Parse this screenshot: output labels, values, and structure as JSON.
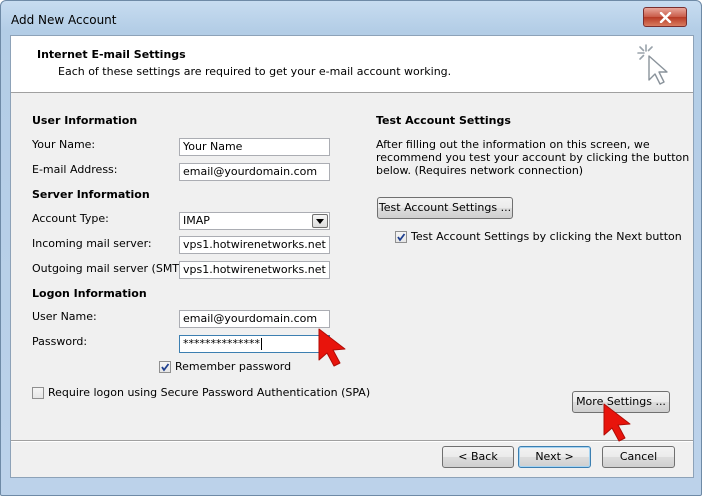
{
  "window": {
    "title": "Add New Account"
  },
  "header": {
    "title": "Internet E-mail Settings",
    "subtitle": "Each of these settings are required to get your e-mail account working."
  },
  "user_info": {
    "heading": "User Information",
    "name_label": "Your Name:",
    "name_value": "Your Name",
    "email_label": "E-mail Address:",
    "email_value": "email@yourdomain.com"
  },
  "server_info": {
    "heading": "Server Information",
    "account_type_label": "Account Type:",
    "account_type_value": "IMAP",
    "incoming_label": "Incoming mail server:",
    "incoming_value": "vps1.hotwirenetworks.net",
    "outgoing_label": "Outgoing mail server (SMTP):",
    "outgoing_value": "vps1.hotwirenetworks.net"
  },
  "logon_info": {
    "heading": "Logon Information",
    "username_label": "User Name:",
    "username_value": "email@yourdomain.com",
    "password_label": "Password:",
    "password_value": "**************",
    "remember_label": "Remember password",
    "remember_checked": true,
    "spa_label": "Require logon using Secure Password Authentication (SPA)",
    "spa_checked": false
  },
  "test_settings": {
    "heading": "Test Account Settings",
    "description_line1": "After filling out the information on this screen, we",
    "description_line2": "recommend you test your account by clicking the button",
    "description_line3": "below. (Requires network connection)",
    "test_button": "Test Account Settings ...",
    "auto_test_label": "Test Account Settings by clicking the Next button",
    "auto_test_checked": true
  },
  "buttons": {
    "more_settings": "More Settings ...",
    "back": "< Back",
    "next": "Next >",
    "cancel": "Cancel"
  },
  "colors": {
    "annotation_arrow": "#e8140c",
    "titlebar": "#b3cde6",
    "close_button": "#c85b48"
  },
  "icons": {
    "close": "close-icon",
    "header": "cursor-click-icon",
    "dropdown": "chevron-down-icon",
    "annotation": "red-pointer-arrow-icon"
  }
}
